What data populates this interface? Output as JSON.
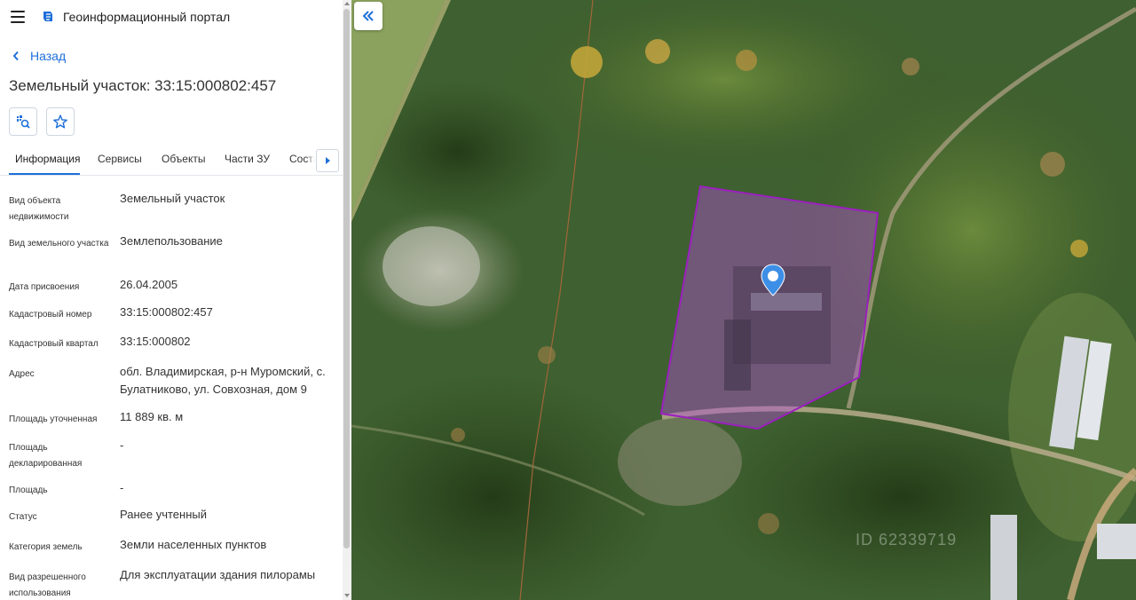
{
  "header": {
    "app_title": "Геоинформационный портал"
  },
  "nav": {
    "back_label": "Назад"
  },
  "page": {
    "title": "Земельный участок: 33:15:000802:457"
  },
  "tabs": [
    {
      "label": "Информация",
      "active": true
    },
    {
      "label": "Сервисы",
      "active": false
    },
    {
      "label": "Объекты",
      "active": false
    },
    {
      "label": "Части ЗУ",
      "active": false
    },
    {
      "label": "Соста",
      "active": false
    }
  ],
  "properties": [
    {
      "label": "Вид объекта недвижимости",
      "value": "Земельный участок"
    },
    {
      "label": "Вид земельного участка",
      "value": "Землепользование"
    },
    {
      "label": "Дата присвоения",
      "value": "26.04.2005"
    },
    {
      "label": "Кадастровый номер",
      "value": "33:15:000802:457"
    },
    {
      "label": "Кадастровый квартал",
      "value": "33:15:000802"
    },
    {
      "label": "Адрес",
      "value": "обл. Владимирская, р-н Муромский, с. Булатниково, ул. Совхозная, дом 9"
    },
    {
      "label": "Площадь уточненная",
      "value": "11 889 кв. м"
    },
    {
      "label": "Площадь декларированная",
      "value": "-"
    },
    {
      "label": "Площадь",
      "value": "-"
    },
    {
      "label": "Статус",
      "value": "Ранее учтенный"
    },
    {
      "label": "Категория земель",
      "value": "Земли населенных пунктов"
    },
    {
      "label": "Вид разрешенного использования",
      "value": "Для эксплуатации здания пилорамы"
    }
  ],
  "map": {
    "watermark_id": "ID 62339719"
  },
  "icons": {
    "menu": "menu-icon",
    "logo": "portal-logo-icon",
    "back": "chevron-left-icon",
    "locate": "map-search-icon",
    "favorite": "star-icon",
    "tab_scroll": "chevron-right-icon",
    "collapse": "double-chevron-left-icon",
    "marker": "map-pin-icon"
  },
  "colors": {
    "accent": "#1e6fd9",
    "parcel_fill": "#b04fd0",
    "parcel_stroke": "#9b1fbf",
    "text": "#333333"
  }
}
